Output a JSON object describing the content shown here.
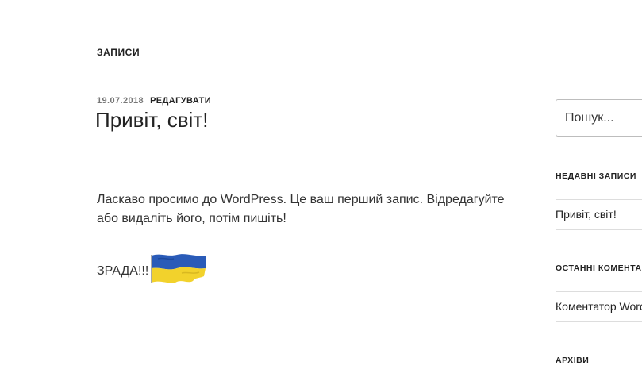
{
  "main": {
    "section_title": "ЗАПИСИ",
    "post": {
      "date": "19.07.2018",
      "edit_label": "РЕДАГУВАТИ",
      "title": "Привіт, світ!",
      "body": "Ласкаво просимо до WordPress. Це ваш перший запис. Відредагуйте або видаліть його, потім пишіть!",
      "zrada": "ЗРАДА!!!",
      "flag_icon": "ukraine-flag-icon"
    }
  },
  "sidebar": {
    "search": {
      "placeholder": "Пошук..."
    },
    "recent_posts": {
      "title": "НЕДАВНІ ЗАПИСИ",
      "items": [
        "Привіт, світ!"
      ]
    },
    "recent_comments": {
      "title": "ОСТАННІ КОМЕНТАРІ",
      "items": [
        "Коментатор WordPress"
      ]
    },
    "archives": {
      "title": "АРХІВИ"
    }
  },
  "colors": {
    "flag_blue": "#2a5bb8",
    "flag_yellow": "#f2d22c",
    "meta_gray": "#767676"
  }
}
